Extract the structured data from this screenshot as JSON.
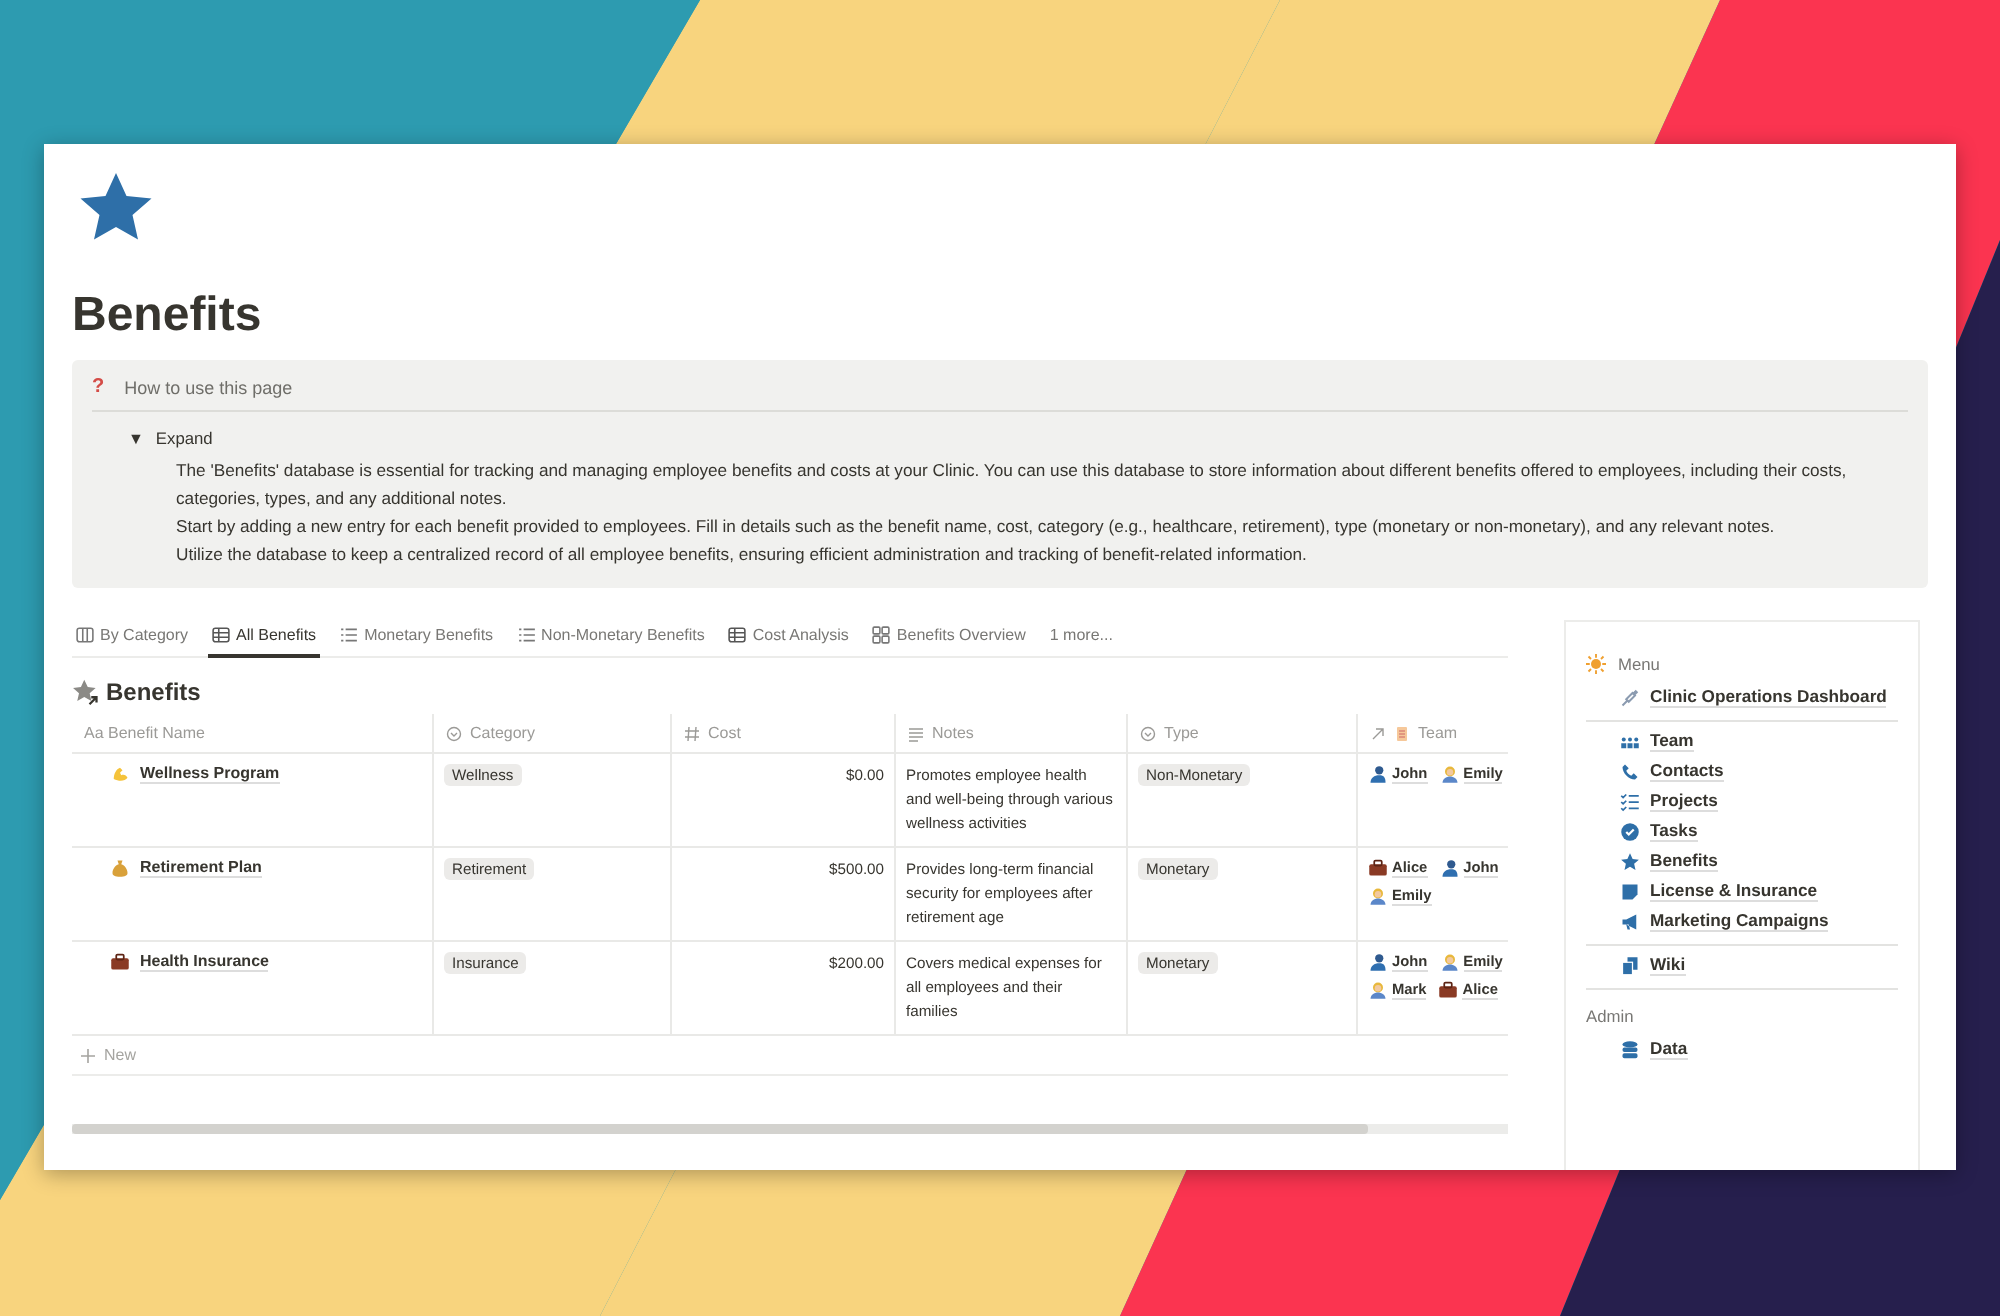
{
  "page": {
    "title": "Benefits"
  },
  "callout": {
    "icon": "?",
    "title": "How to use this page",
    "toggle": {
      "marker": "▼",
      "label": "Expand",
      "expanded": true
    },
    "paragraphs": [
      "The 'Benefits' database is essential for tracking and managing employee benefits and costs at your Clinic. You can use this database to store information about different benefits offered to employees, including their costs, categories, types, and any additional notes.",
      "Start by adding a new entry for each benefit provided to employees. Fill in details such as the benefit name, cost, category (e.g., healthcare, retirement), type (monetary or non-monetary), and any relevant notes.",
      "Utilize the database to keep a centralized record of all employee benefits, ensuring efficient administration and tracking of benefit-related information."
    ]
  },
  "views": [
    {
      "label": "By Category",
      "kind": "board",
      "selected": false
    },
    {
      "label": "All Benefits",
      "kind": "table",
      "selected": true
    },
    {
      "label": "Monetary Benefits",
      "kind": "list",
      "selected": false
    },
    {
      "label": "Non-Monetary Benefits",
      "kind": "list",
      "selected": false
    },
    {
      "label": "Cost Analysis",
      "kind": "table",
      "selected": false
    },
    {
      "label": "Benefits Overview",
      "kind": "gallery",
      "selected": false
    },
    {
      "label": "1 more...",
      "kind": "more",
      "selected": false
    }
  ],
  "database": {
    "title": "Benefits",
    "columns": [
      {
        "label": "Aa Benefit Name",
        "kind": "title"
      },
      {
        "label": "Category",
        "kind": "select"
      },
      {
        "label": "Cost",
        "kind": "number"
      },
      {
        "label": "Notes",
        "kind": "text"
      },
      {
        "label": "Type",
        "kind": "select"
      },
      {
        "label": "Team",
        "kind": "relation"
      }
    ],
    "rows": [
      {
        "kind": "muscle",
        "name": "Wellness Program",
        "category": "Wellness",
        "cost": "$0.00",
        "notes": "Promotes employee health and well-being through various wellness activities",
        "type": "Non-Monetary",
        "team": [
          {
            "name": "John",
            "kind": "man"
          },
          {
            "name": "Emily",
            "kind": "woman"
          }
        ]
      },
      {
        "kind": "moneybag",
        "name": "Retirement Plan",
        "category": "Retirement",
        "cost": "$500.00",
        "notes": "Provides long-term financial security for employees after retirement age",
        "type": "Monetary",
        "team": [
          {
            "name": "Alice",
            "kind": "briefcase"
          },
          {
            "name": "John",
            "kind": "man"
          },
          {
            "name": "Emily",
            "kind": "woman"
          }
        ]
      },
      {
        "kind": "briefcase",
        "name": "Health Insurance",
        "category": "Insurance",
        "cost": "$200.00",
        "notes": "Covers medical expenses for all employees and their families",
        "type": "Monetary",
        "team": [
          {
            "name": "John",
            "kind": "man"
          },
          {
            "name": "Emily",
            "kind": "woman"
          },
          {
            "name": "Mark",
            "kind": "woman"
          },
          {
            "name": "Alice",
            "kind": "briefcase"
          }
        ]
      }
    ],
    "new_label": "New"
  },
  "sidebar": {
    "sections": [
      {
        "kind": "featured",
        "heading": "Menu",
        "items": [
          {
            "label": "Clinic Operations Dashboard",
            "kind": "syringe"
          }
        ]
      },
      {
        "items": [
          {
            "label": "Team",
            "kind": "people"
          },
          {
            "label": "Contacts",
            "kind": "phone"
          },
          {
            "label": "Projects",
            "kind": "checklist"
          },
          {
            "label": "Tasks",
            "kind": "check"
          },
          {
            "label": "Benefits",
            "kind": "star"
          },
          {
            "label": "License & Insurance",
            "kind": "note"
          },
          {
            "label": "Marketing Campaigns",
            "kind": "megaphone"
          }
        ]
      },
      {
        "items": [
          {
            "label": "Wiki",
            "kind": "docs"
          }
        ]
      },
      {
        "kind": "plain",
        "heading": "Admin",
        "items": [
          {
            "label": "Data",
            "kind": "database"
          }
        ]
      }
    ]
  }
}
